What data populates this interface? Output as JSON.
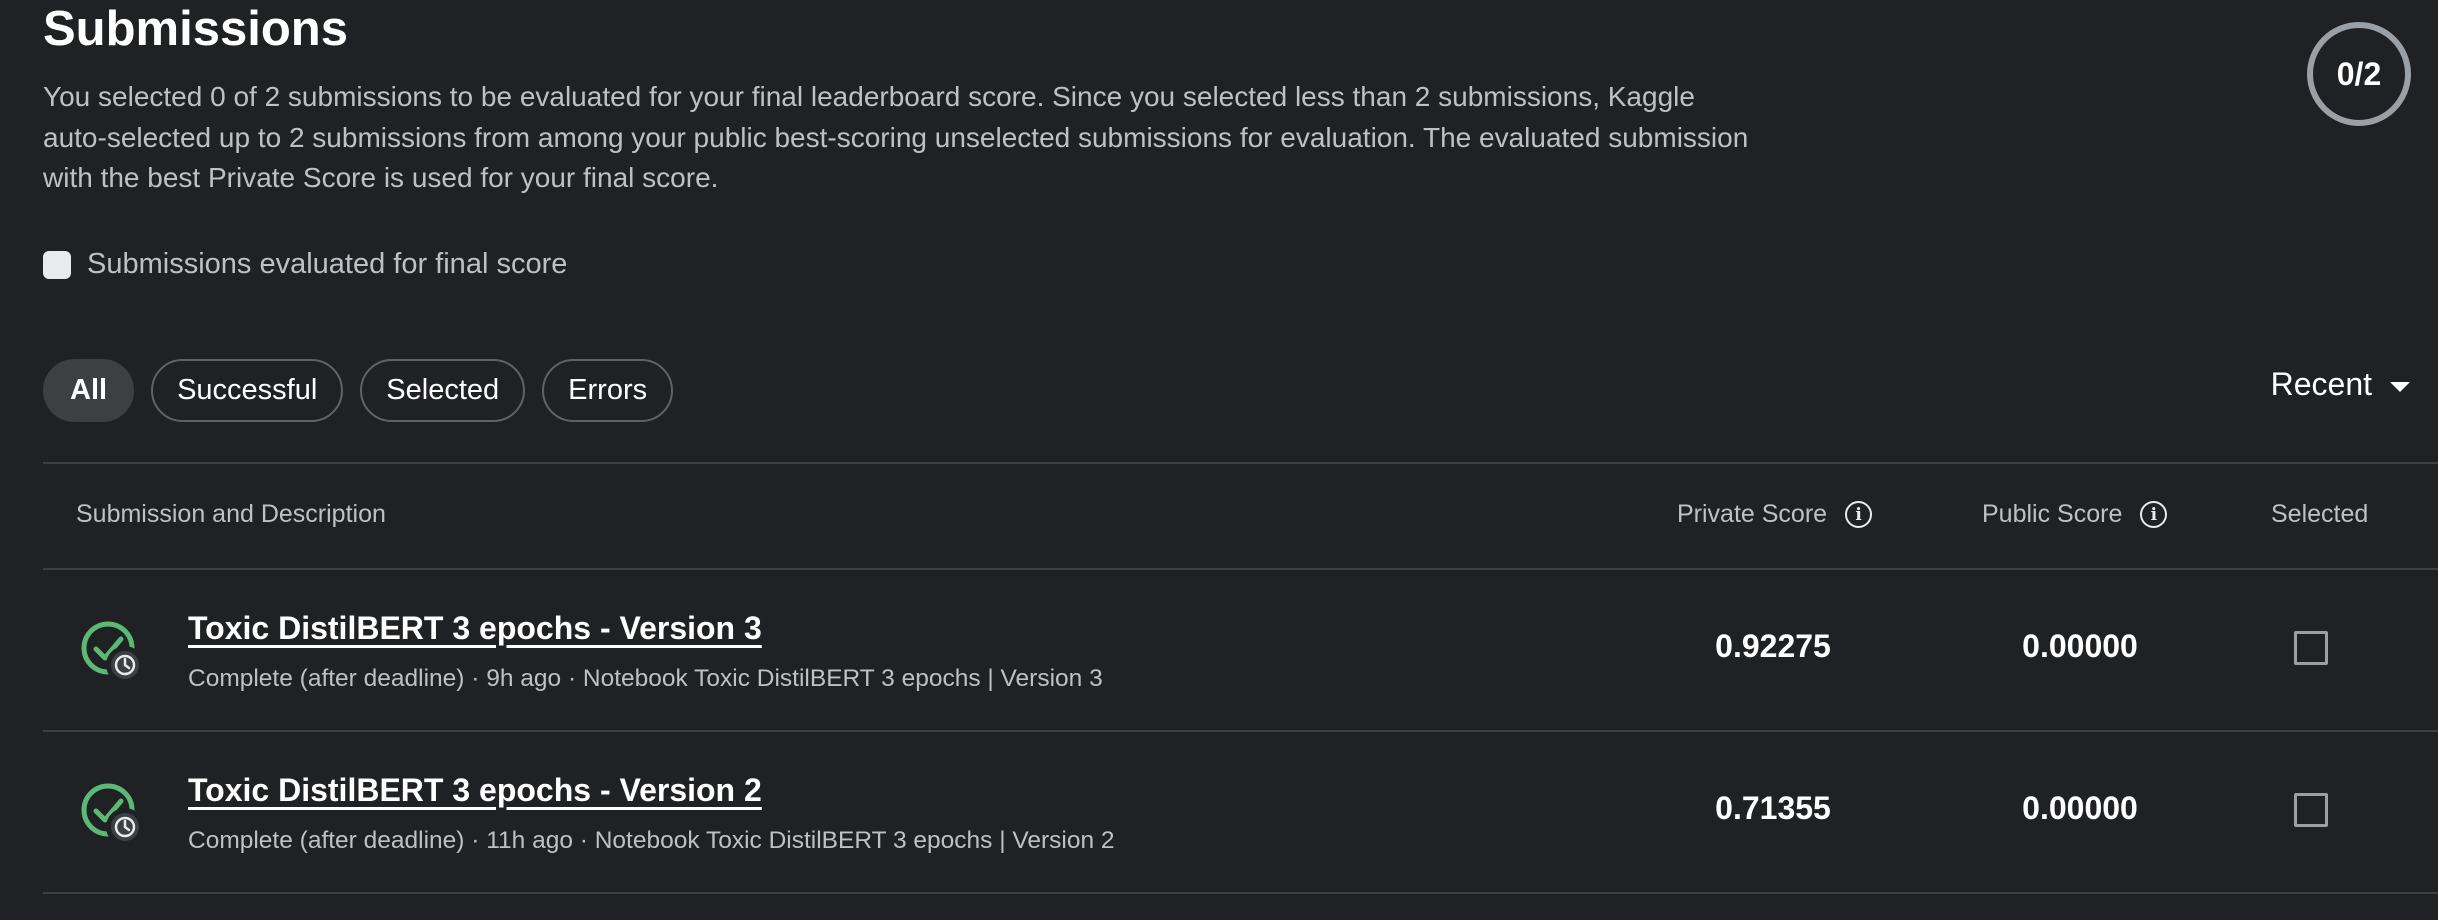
{
  "header": {
    "title": "Submissions",
    "description": "You selected 0 of 2 submissions to be evaluated for your final leaderboard score. Since you selected less than 2 submissions, Kaggle auto-selected up to 2 submissions from among your public best-scoring unselected submissions for evaluation. The evaluated submission with the best Private Score is used for your final score.",
    "counter": "0/2"
  },
  "filter": {
    "eval_label": "Submissions evaluated for final score",
    "chips": [
      "All",
      "Successful",
      "Selected",
      "Errors"
    ],
    "active_chip": "All",
    "sort_label": "Recent"
  },
  "table": {
    "columns": {
      "submission": "Submission and Description",
      "private": "Private Score",
      "public": "Public Score",
      "selected": "Selected"
    },
    "rows": [
      {
        "title": "Toxic DistilBERT 3 epochs - Version 3",
        "meta": "Complete (after deadline) · 9h ago · Notebook Toxic DistilBERT 3 epochs | Version 3",
        "private_score": "0.92275",
        "public_score": "0.00000",
        "selected": false
      },
      {
        "title": "Toxic DistilBERT 3 epochs - Version 2",
        "meta": "Complete (after deadline) · 11h ago · Notebook Toxic DistilBERT 3 epochs | Version 2",
        "private_score": "0.71355",
        "public_score": "0.00000",
        "selected": false
      }
    ]
  },
  "icons": {
    "status": "check-circle-with-clock-icon",
    "info": "info-icon",
    "sort": "caret-down-icon"
  },
  "colors": {
    "background": "#202124",
    "success_green": "#5bb974"
  }
}
